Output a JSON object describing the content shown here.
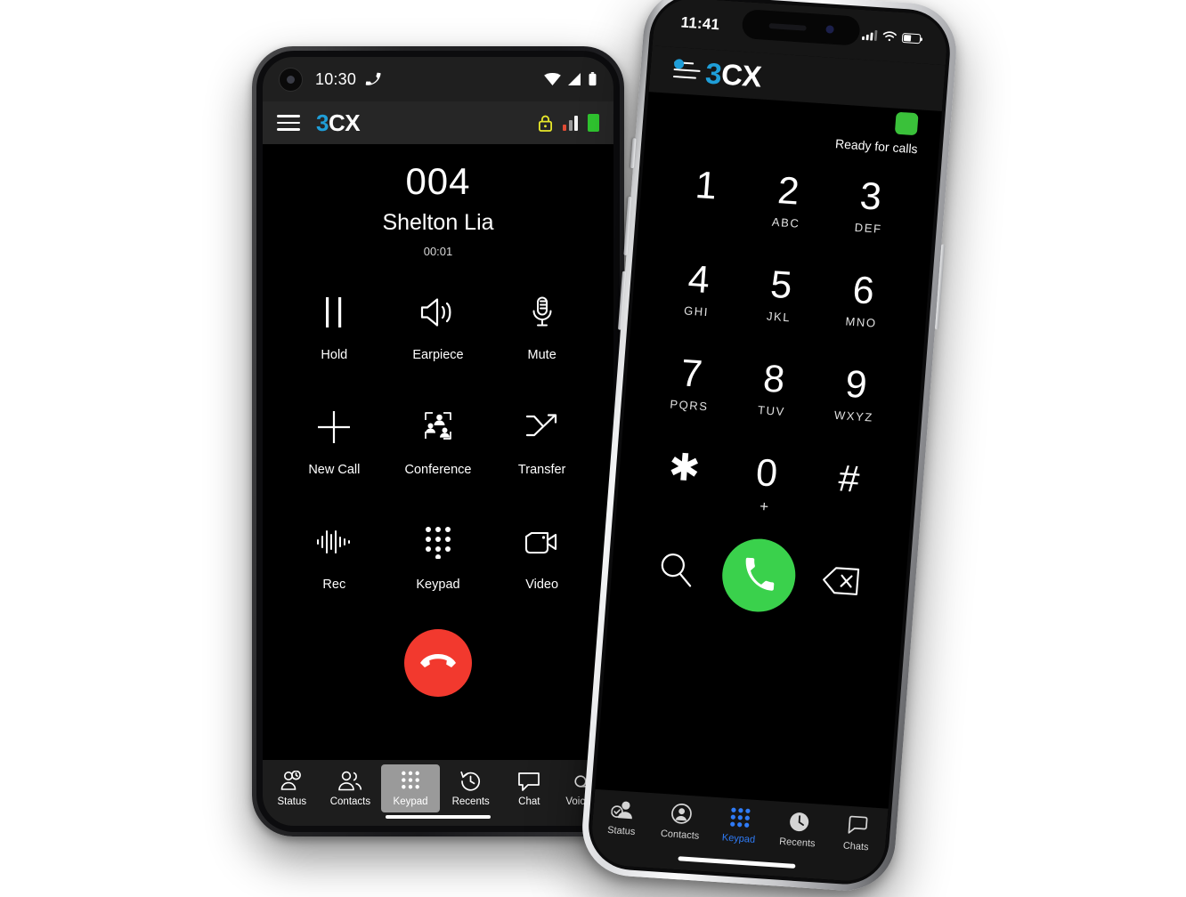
{
  "android": {
    "status_bar": {
      "time": "10:30",
      "call_icon": "phone-handset-icon",
      "wifi_icon": "wifi-icon",
      "signal_icon": "cellular-signal-icon",
      "battery_icon": "battery-icon"
    },
    "app_bar": {
      "menu_icon": "hamburger-menu-icon",
      "logo_blue": "3",
      "logo_white": "CX",
      "lock_icon": "lock-icon",
      "lock_color": "#e8e82a",
      "signal_bars_icon": "signal-bars-icon",
      "status_block_color": "#2fc42f"
    },
    "call": {
      "number": "004",
      "name": "Shelton Lia",
      "duration": "00:01"
    },
    "controls": [
      {
        "label": "Hold",
        "icon": "pause-icon"
      },
      {
        "label": "Earpiece",
        "icon": "speaker-icon"
      },
      {
        "label": "Mute",
        "icon": "microphone-icon"
      },
      {
        "label": "New Call",
        "icon": "plus-icon"
      },
      {
        "label": "Conference",
        "icon": "conference-icon"
      },
      {
        "label": "Transfer",
        "icon": "transfer-arrow-icon"
      },
      {
        "label": "Rec",
        "icon": "waveform-icon"
      },
      {
        "label": "Keypad",
        "icon": "dialpad-icon"
      },
      {
        "label": "Video",
        "icon": "video-camera-icon"
      }
    ],
    "hangup": {
      "icon": "end-call-icon",
      "color": "#f2392e"
    },
    "tabs": [
      {
        "label": "Status",
        "icon": "status-person-clock-icon",
        "selected": false
      },
      {
        "label": "Contacts",
        "icon": "contacts-people-icon",
        "selected": false
      },
      {
        "label": "Keypad",
        "icon": "dialpad-icon",
        "selected": true
      },
      {
        "label": "Recents",
        "icon": "clock-history-icon",
        "selected": false
      },
      {
        "label": "Chat",
        "icon": "chat-bubble-icon",
        "selected": false
      },
      {
        "label": "Voicemail",
        "icon": "voicemail-icon",
        "selected": false
      }
    ]
  },
  "iphone": {
    "status_bar": {
      "time": "11:41",
      "signal_icon": "cellular-signal-icon",
      "wifi_icon": "wifi-icon",
      "battery_icon": "battery-icon"
    },
    "app_bar": {
      "menu_icon": "hamburger-menu-dot-icon",
      "logo_blue": "3",
      "logo_white": "CX"
    },
    "presence": {
      "status_color": "#3ac13a",
      "status_text": "Ready for calls",
      "status_icon": "presence-available-icon"
    },
    "dialpad": [
      {
        "digit": "1",
        "letters": ""
      },
      {
        "digit": "2",
        "letters": "ABC"
      },
      {
        "digit": "3",
        "letters": "DEF"
      },
      {
        "digit": "4",
        "letters": "GHI"
      },
      {
        "digit": "5",
        "letters": "JKL"
      },
      {
        "digit": "6",
        "letters": "MNO"
      },
      {
        "digit": "7",
        "letters": "PQRS"
      },
      {
        "digit": "8",
        "letters": "TUV"
      },
      {
        "digit": "9",
        "letters": "WXYZ"
      },
      {
        "digit": "✱",
        "letters": ""
      },
      {
        "digit": "0",
        "letters": "+"
      },
      {
        "digit": "#",
        "letters": ""
      }
    ],
    "actions": {
      "search_icon": "search-icon",
      "call_icon": "call-handset-icon",
      "call_color": "#3ad14c",
      "backspace_icon": "backspace-icon"
    },
    "tabs": [
      {
        "label": "Status",
        "icon": "status-person-check-icon",
        "selected": false
      },
      {
        "label": "Contacts",
        "icon": "contact-person-icon",
        "selected": false
      },
      {
        "label": "Keypad",
        "icon": "dialpad-icon",
        "selected": true
      },
      {
        "label": "Recents",
        "icon": "clock-icon",
        "selected": false
      },
      {
        "label": "Chats",
        "icon": "chat-bubble-icon",
        "selected": false
      }
    ]
  }
}
